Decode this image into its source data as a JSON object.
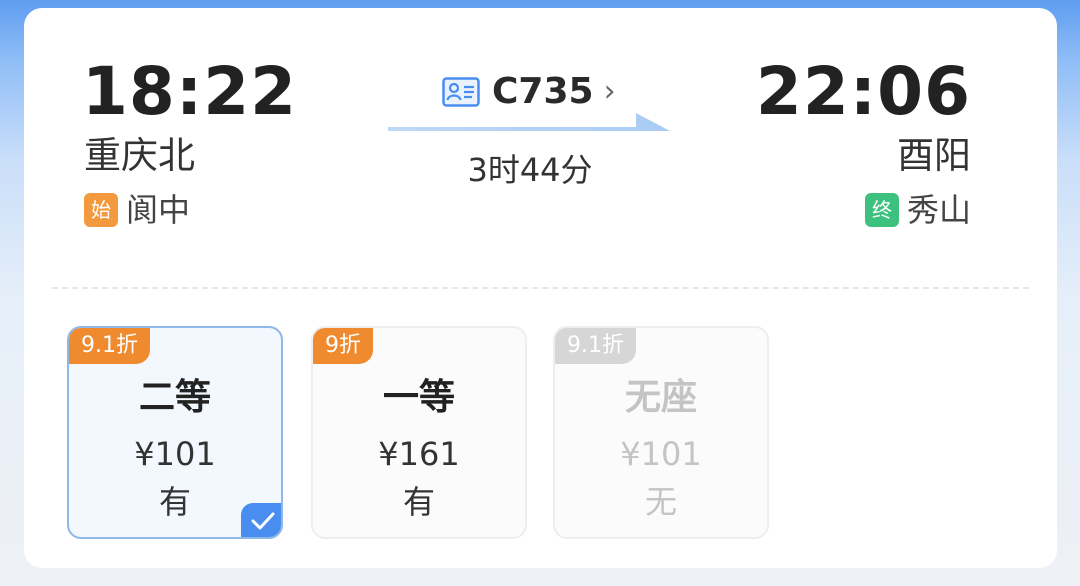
{
  "departure": {
    "time": "18:22",
    "station": "重庆北",
    "terminal_badge": "始",
    "terminal": "阆中"
  },
  "arrival": {
    "time": "22:06",
    "station": "酉阳",
    "terminal_badge": "终",
    "terminal": "秀山"
  },
  "train": {
    "number": "C735",
    "icon": "id-card-icon",
    "chevron": "›",
    "duration": "3时44分"
  },
  "seats": [
    {
      "discount": "9.1折",
      "name": "二等",
      "price": "¥101",
      "availability": "有",
      "selected": true,
      "disabled": false
    },
    {
      "discount": "9折",
      "name": "一等",
      "price": "¥161",
      "availability": "有",
      "selected": false,
      "disabled": false
    },
    {
      "discount": "9.1折",
      "name": "无座",
      "price": "¥101",
      "availability": "无",
      "selected": false,
      "disabled": true
    }
  ],
  "colors": {
    "accent": "#4a8df0",
    "start_badge": "#f29a3d",
    "end_badge": "#3cc27e",
    "discount": "#ef8a2e"
  }
}
